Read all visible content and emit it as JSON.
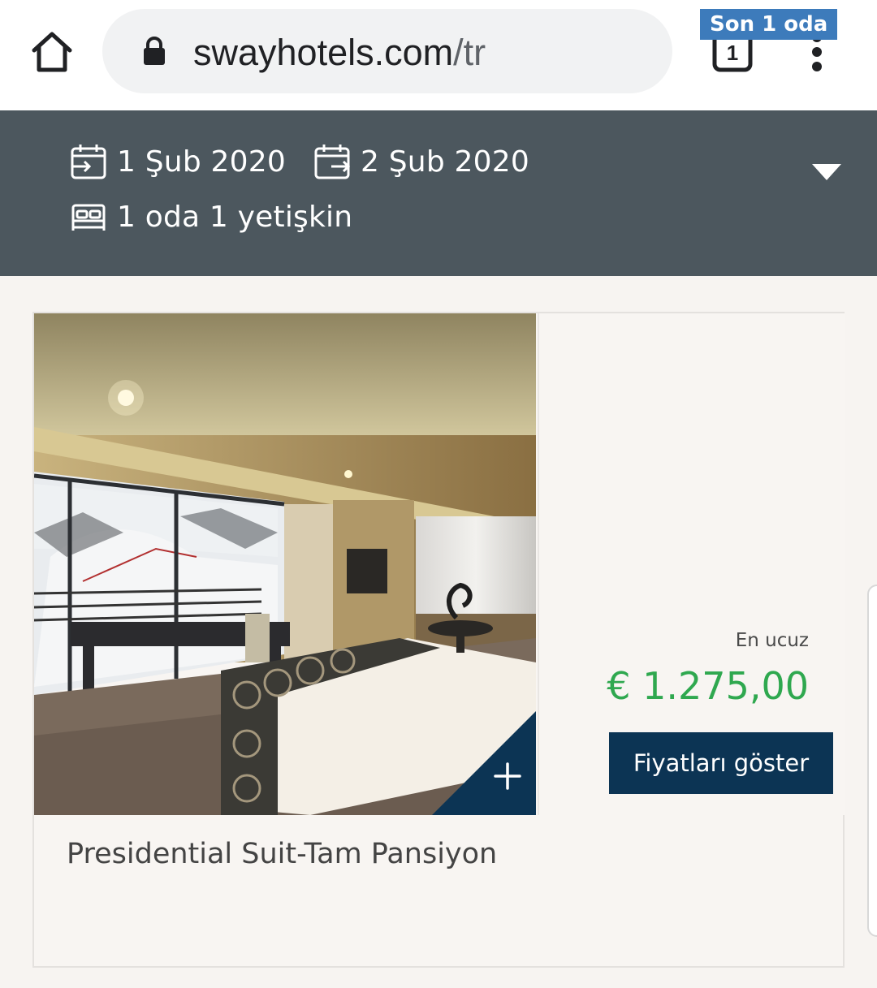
{
  "browser": {
    "url_domain": "swayhotels.com",
    "url_path": "/tr",
    "tab_count": "1",
    "icons": [
      "home-icon",
      "lock-icon",
      "tabs-icon",
      "menu-dots-icon"
    ]
  },
  "booking": {
    "checkin": "1 Şub 2020",
    "checkout": "2 Şub 2020",
    "guests": "1 oda 1 yetişkin",
    "icons": [
      "calendar-checkin-icon",
      "calendar-checkout-icon",
      "bed-icon",
      "chevron-down-icon"
    ]
  },
  "room": {
    "badge": "Son 1 oda",
    "price_label": "En ucuz",
    "price": "€ 1.275,00",
    "cta_label": "Fiyatları göster",
    "name": "Presidential Suit-Tam Pansiyon",
    "image_alt": "hotel room photo",
    "icons": [
      "plus-icon"
    ]
  },
  "colors": {
    "header_bg": "#4c575e",
    "badge_bg": "#3d7bbb",
    "price": "#2fa84f",
    "cta_bg": "#0c3454"
  }
}
